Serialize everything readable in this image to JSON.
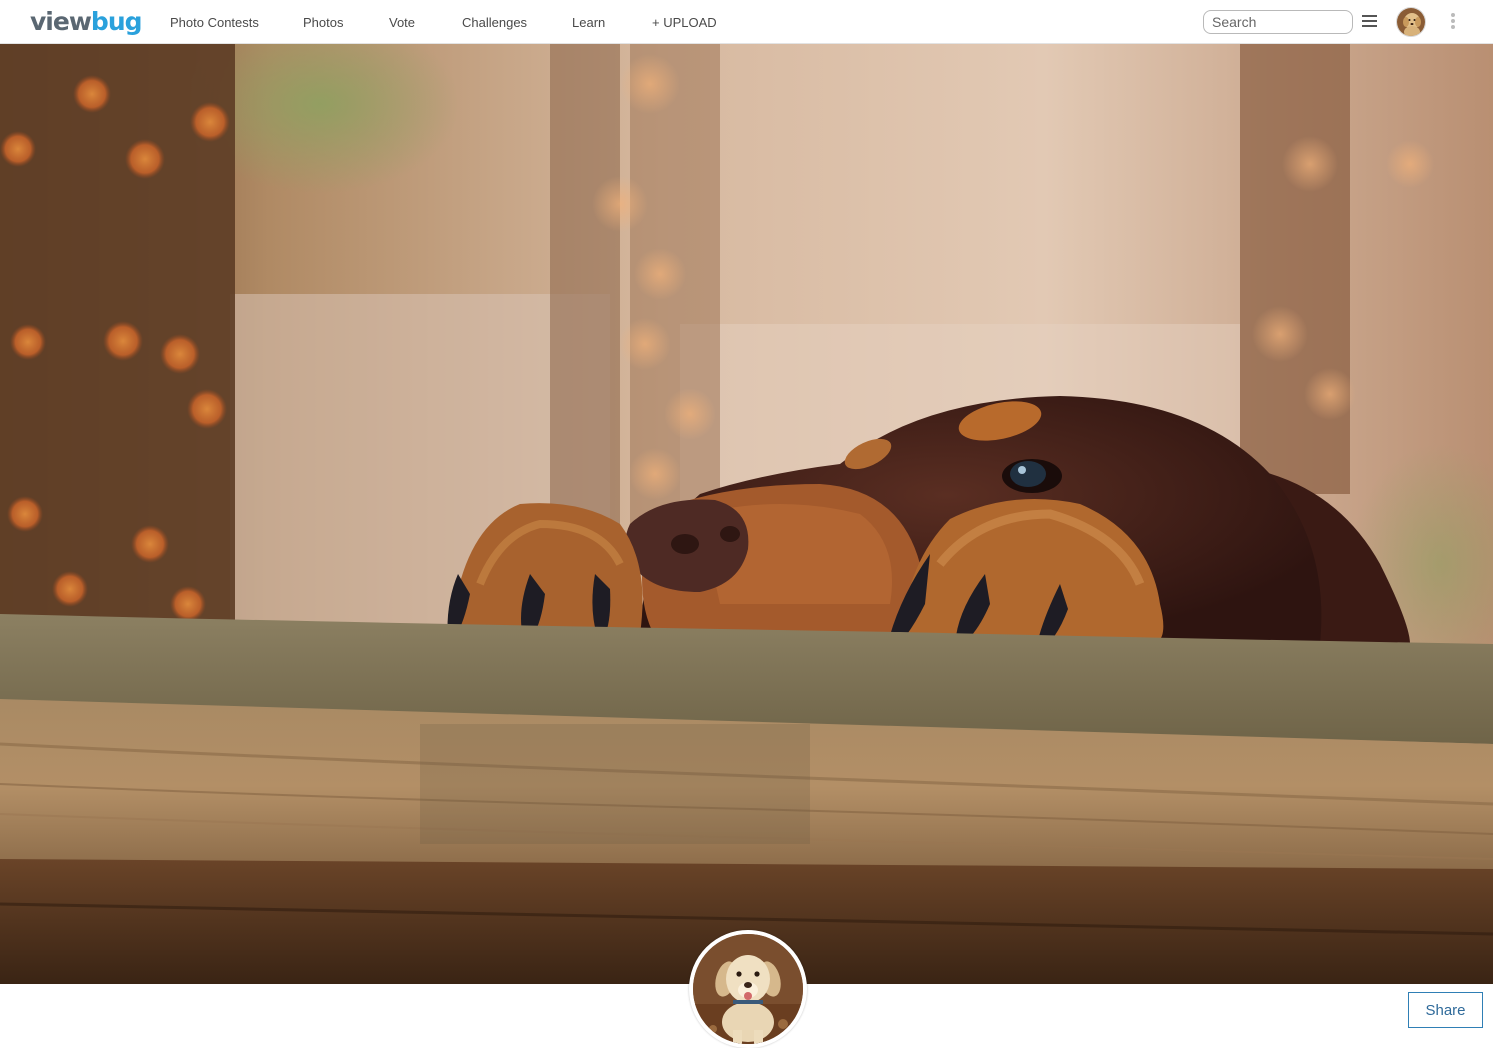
{
  "header": {
    "logo": {
      "part1": "view",
      "part2": "bug"
    },
    "nav": {
      "photo_contests": "Photo Contests",
      "photos": "Photos",
      "vote": "Vote",
      "challenges": "Challenges",
      "learn": "Learn",
      "upload": "+ UPLOAD"
    },
    "search": {
      "placeholder": "Search",
      "value": ""
    },
    "icons": {
      "menu": "hamburger-menu-icon",
      "avatar": "user-avatar",
      "more": "vertical-ellipsis-icon"
    }
  },
  "cover": {
    "subject": "dog-peeking-over-wooden-fence-photo"
  },
  "profile": {
    "avatar": "puppy-profile-photo",
    "share_label": "Share"
  },
  "colors": {
    "logo_gray": "#5a6772",
    "logo_blue": "#2aa1dc",
    "share_border": "#2f7fb5"
  }
}
